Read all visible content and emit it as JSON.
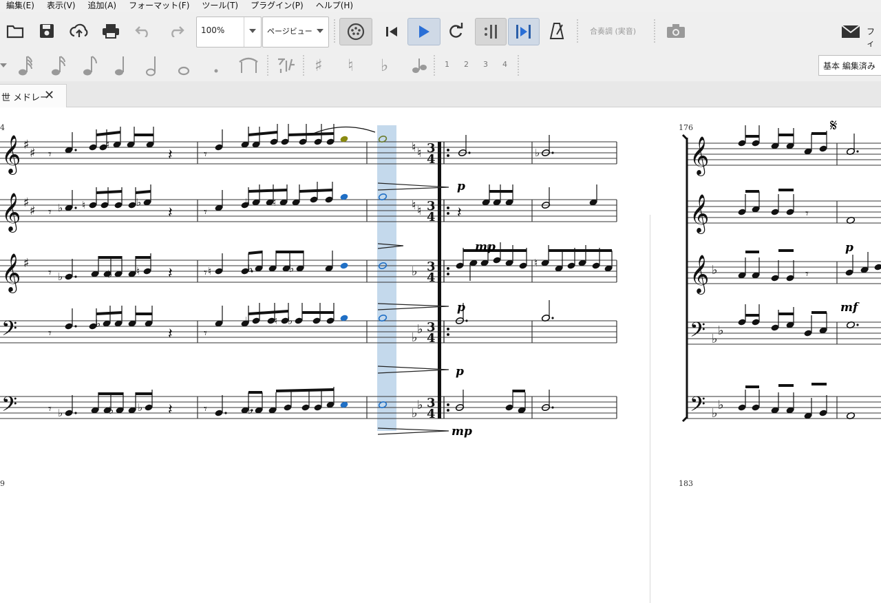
{
  "menu": [
    "編集(E)",
    "表示(V)",
    "追加(A)",
    "フォーマット(F)",
    "ツール(T)",
    "プラグイン(P)",
    "ヘルプ(H)"
  ],
  "toolbar": {
    "zoom_value": "100%",
    "view_mode": "ページビュー",
    "concert_pitch_label": "合奏調 (実音)",
    "feedback_label": "フィー"
  },
  "note_input": {
    "voices": [
      "1",
      "2",
      "3",
      "4"
    ]
  },
  "workspace_label": "基本 編集済み",
  "tab": {
    "title": "世 メドレー",
    "close": "✕"
  },
  "score": {
    "system1_measure": "4",
    "system2_measure": "176",
    "system3_measure": "9",
    "system4_measure": "183",
    "dynamics": {
      "p1": "p",
      "p2": "p",
      "p3": "p",
      "mp_low": "mp",
      "mp_staff3": "mp",
      "p_right": "p",
      "mf_right": "mf"
    },
    "time_signature": {
      "num": "3",
      "den": "4"
    },
    "segno": "𝄋"
  },
  "colors": {
    "selection": "#b9d3ea",
    "note_blue": "#1f6fc5",
    "note_olive": "#8a8a10",
    "play_active": "#2a6fd6"
  }
}
